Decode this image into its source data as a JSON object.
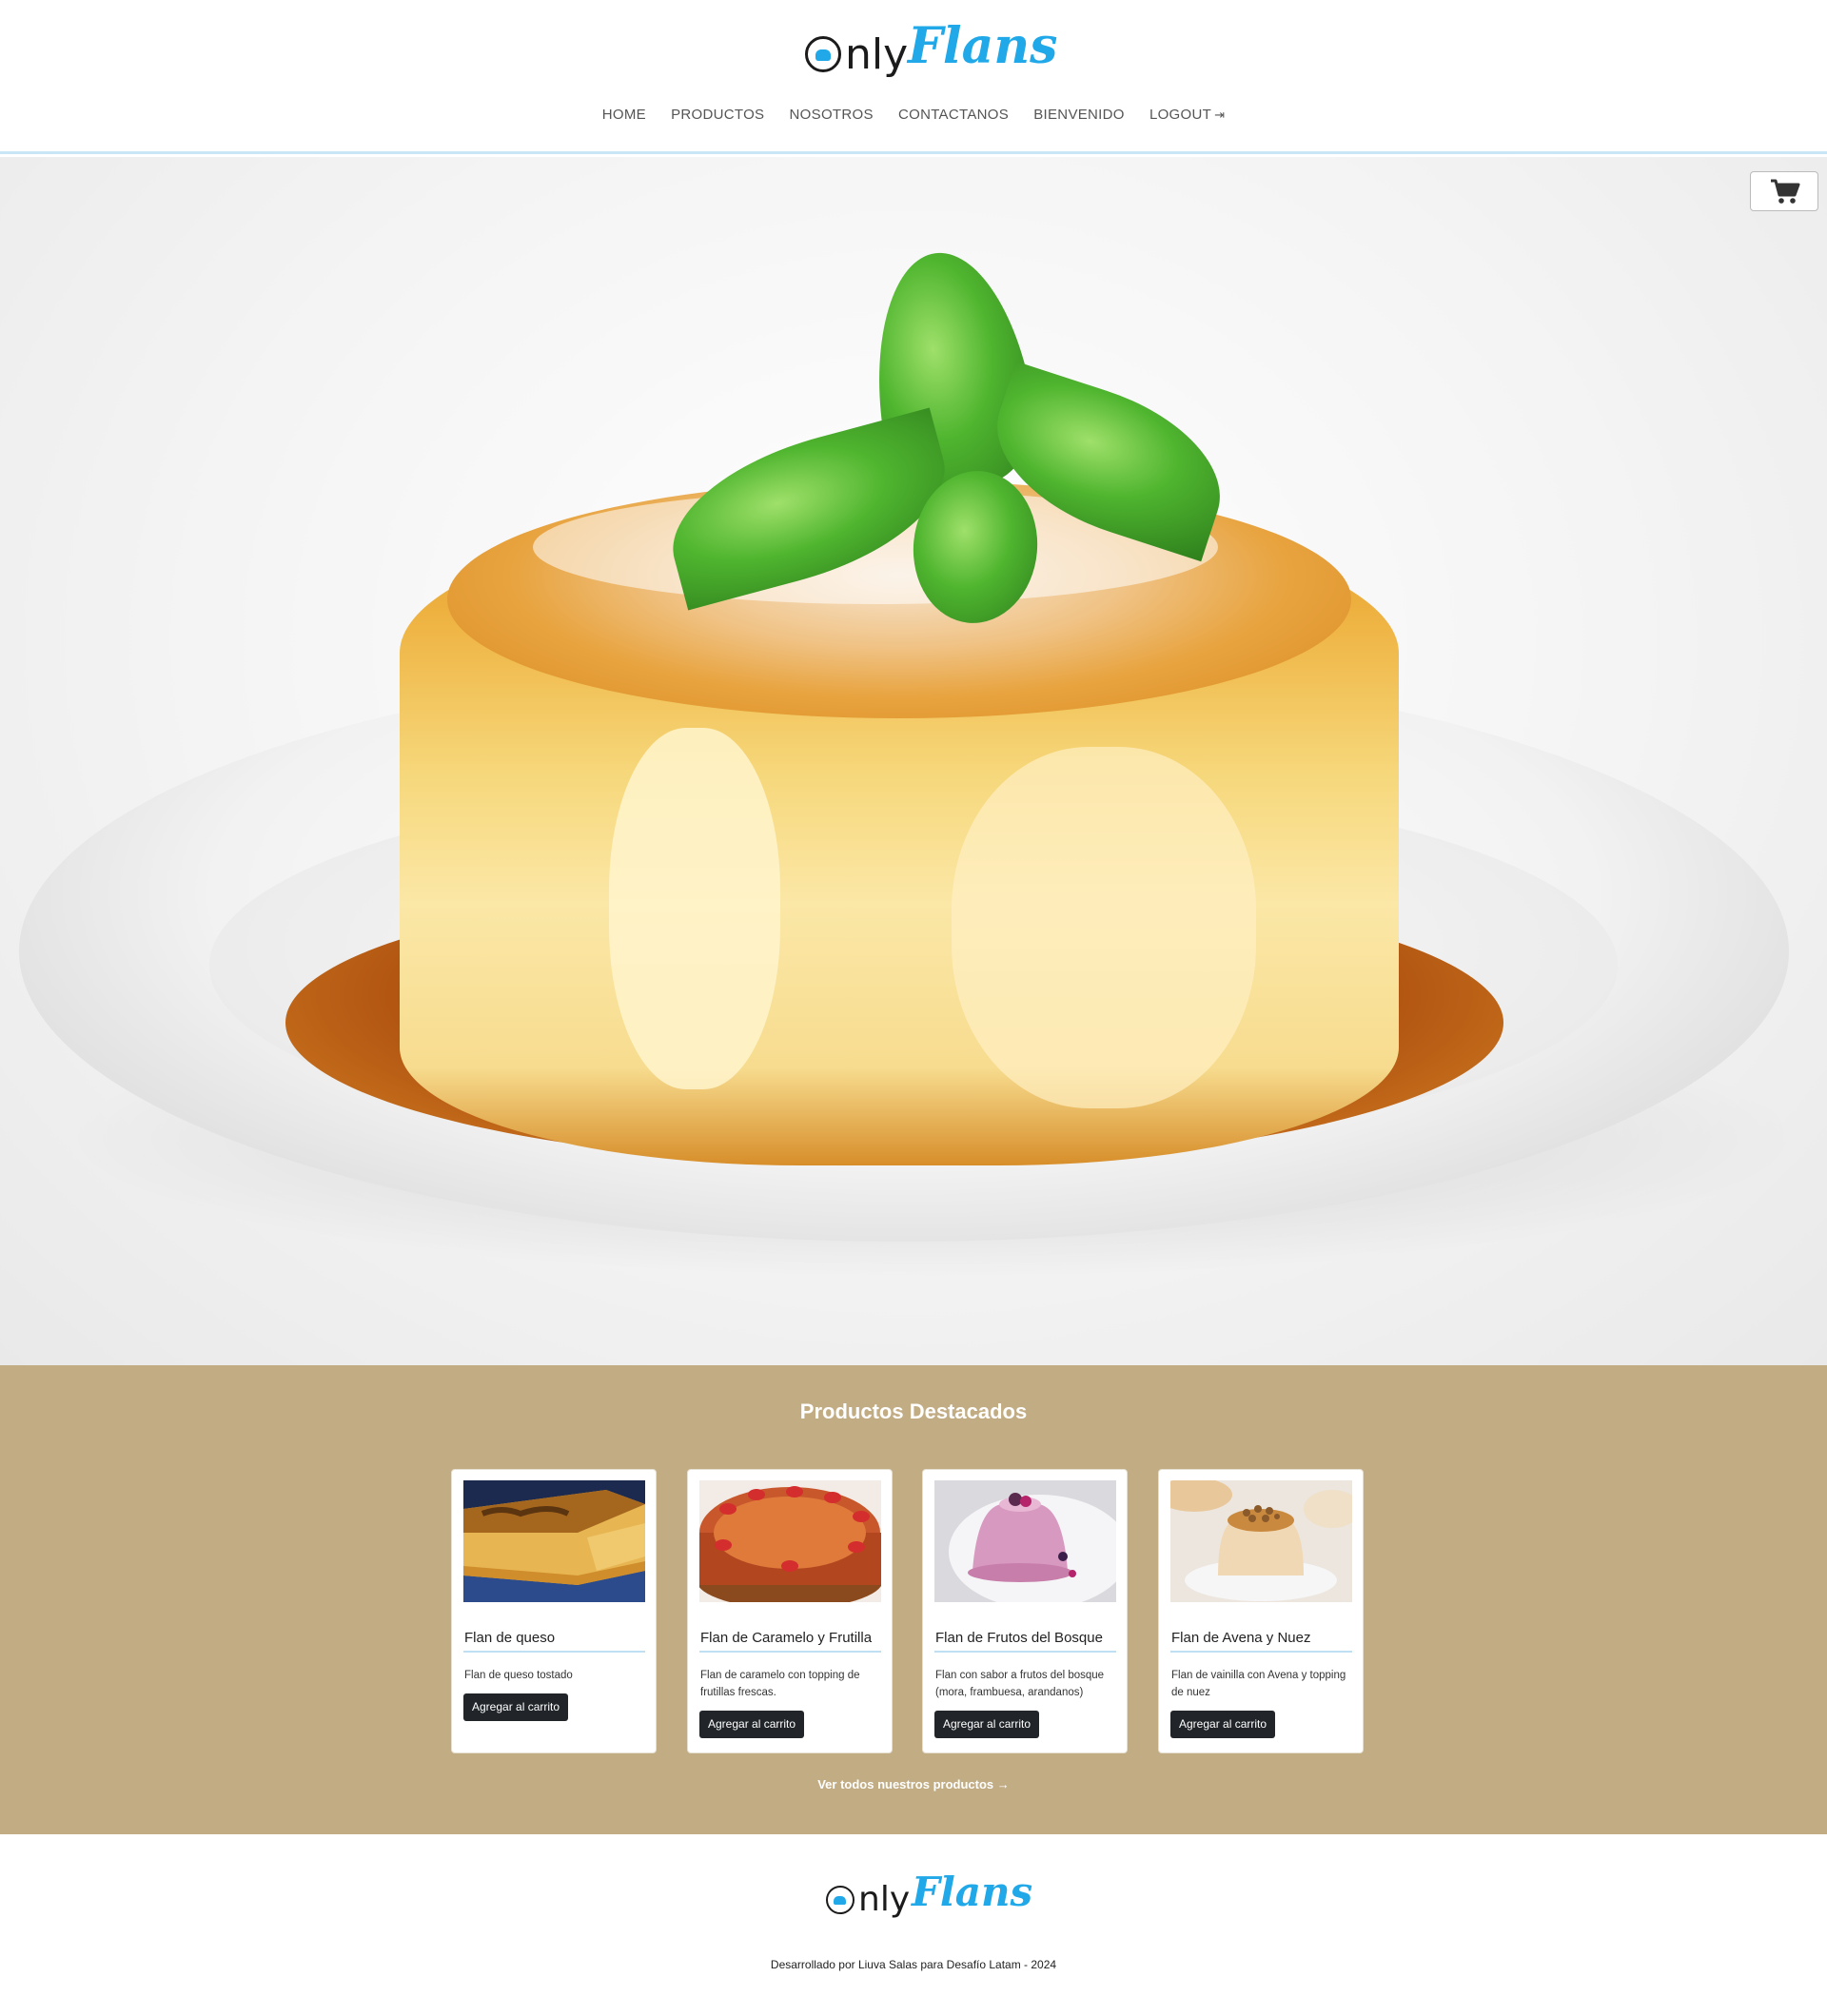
{
  "brand": {
    "word1": "nly",
    "word2": "Flans",
    "accent_color": "#20a8e8"
  },
  "nav": {
    "items": [
      "HOME",
      "PRODUCTOS",
      "NOSOTROS",
      "CONTACTANOS",
      "BIENVENIDO",
      "LOGOUT"
    ],
    "logout_icon": "sign-out-icon"
  },
  "cart": {
    "icon": "shopping-cart-icon"
  },
  "featured": {
    "title": "Productos Destacados",
    "background": "#c2ac84",
    "products": [
      {
        "name": "Flan de queso",
        "description": "Flan de queso tostado",
        "button": "Agregar al carrito"
      },
      {
        "name": "Flan de Caramelo y Frutilla",
        "description": "Flan de caramelo con topping de frutillas frescas.",
        "button": "Agregar al carrito"
      },
      {
        "name": "Flan de Frutos del Bosque",
        "description": "Flan con sabor a frutos del bosque (mora, frambuesa, arandanos)",
        "button": "Agregar al carrito"
      },
      {
        "name": "Flan de Avena y Nuez",
        "description": "Flan de vainilla con Avena y topping de nuez",
        "button": "Agregar al carrito"
      }
    ],
    "see_all": "Ver todos nuestros productos",
    "see_all_icon": "arrow-right-icon"
  },
  "footer": {
    "credit": "Desarrollado por Liuva Salas para Desafío Latam - 2024"
  }
}
